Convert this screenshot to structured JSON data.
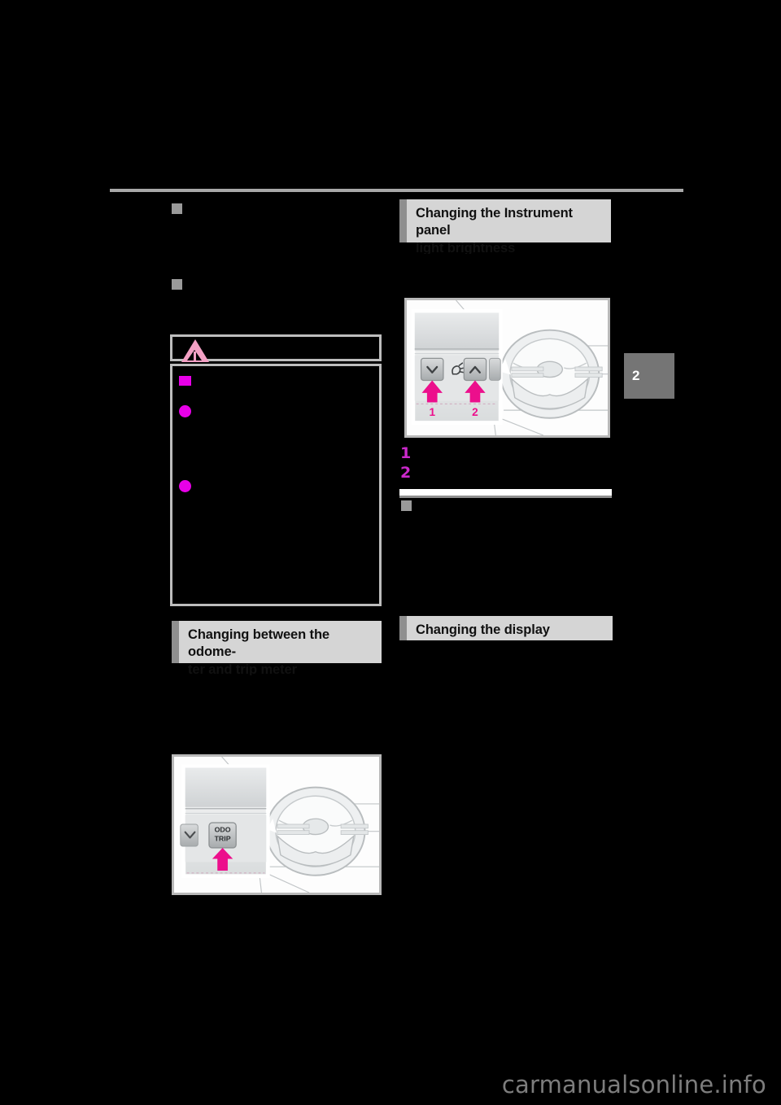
{
  "page": {
    "background_color": "#000000",
    "chapter_tab": "2",
    "watermark": "carmanualsonline.info"
  },
  "left_column": {
    "section_markers": [
      "",
      ""
    ],
    "caution": {
      "label": "",
      "icon": "warning-triangle",
      "bullet_square": "",
      "bullets": [
        "",
        ""
      ]
    },
    "heading": "Changing between the odome-\nter and trip meter",
    "illustration": {
      "alt": "steering wheel and instrument panel with ODO TRIP button",
      "button_label_line1": "ODO",
      "button_label_line2": "TRIP",
      "chevron_icon": "chevron-down-icon",
      "callout_arrow": "magenta-up-arrow"
    }
  },
  "right_column": {
    "heading": "Changing the Instrument panel\nlight brightness",
    "illustration": {
      "alt": "steering wheel and instrument panel light brightness switches",
      "button1_icon": "chevron-down-icon",
      "center_icon": "dimmer-lamp-icon",
      "button2_icon": "chevron-up-icon",
      "callout_number_1": "1",
      "callout_number_2": "2"
    },
    "steps": [
      {
        "number": "1",
        "text": ""
      },
      {
        "number": "2",
        "text": ""
      }
    ],
    "subsection_marker": "",
    "heading2": "Changing the display"
  },
  "colors": {
    "accent_magenta": "#e800e8",
    "caution_pink": "#f3a0c4",
    "heading_bg": "#d5d5d5",
    "heading_bar": "#8f8f8f",
    "rule_gray": "#a8a8a8",
    "tab_gray": "#757575"
  }
}
